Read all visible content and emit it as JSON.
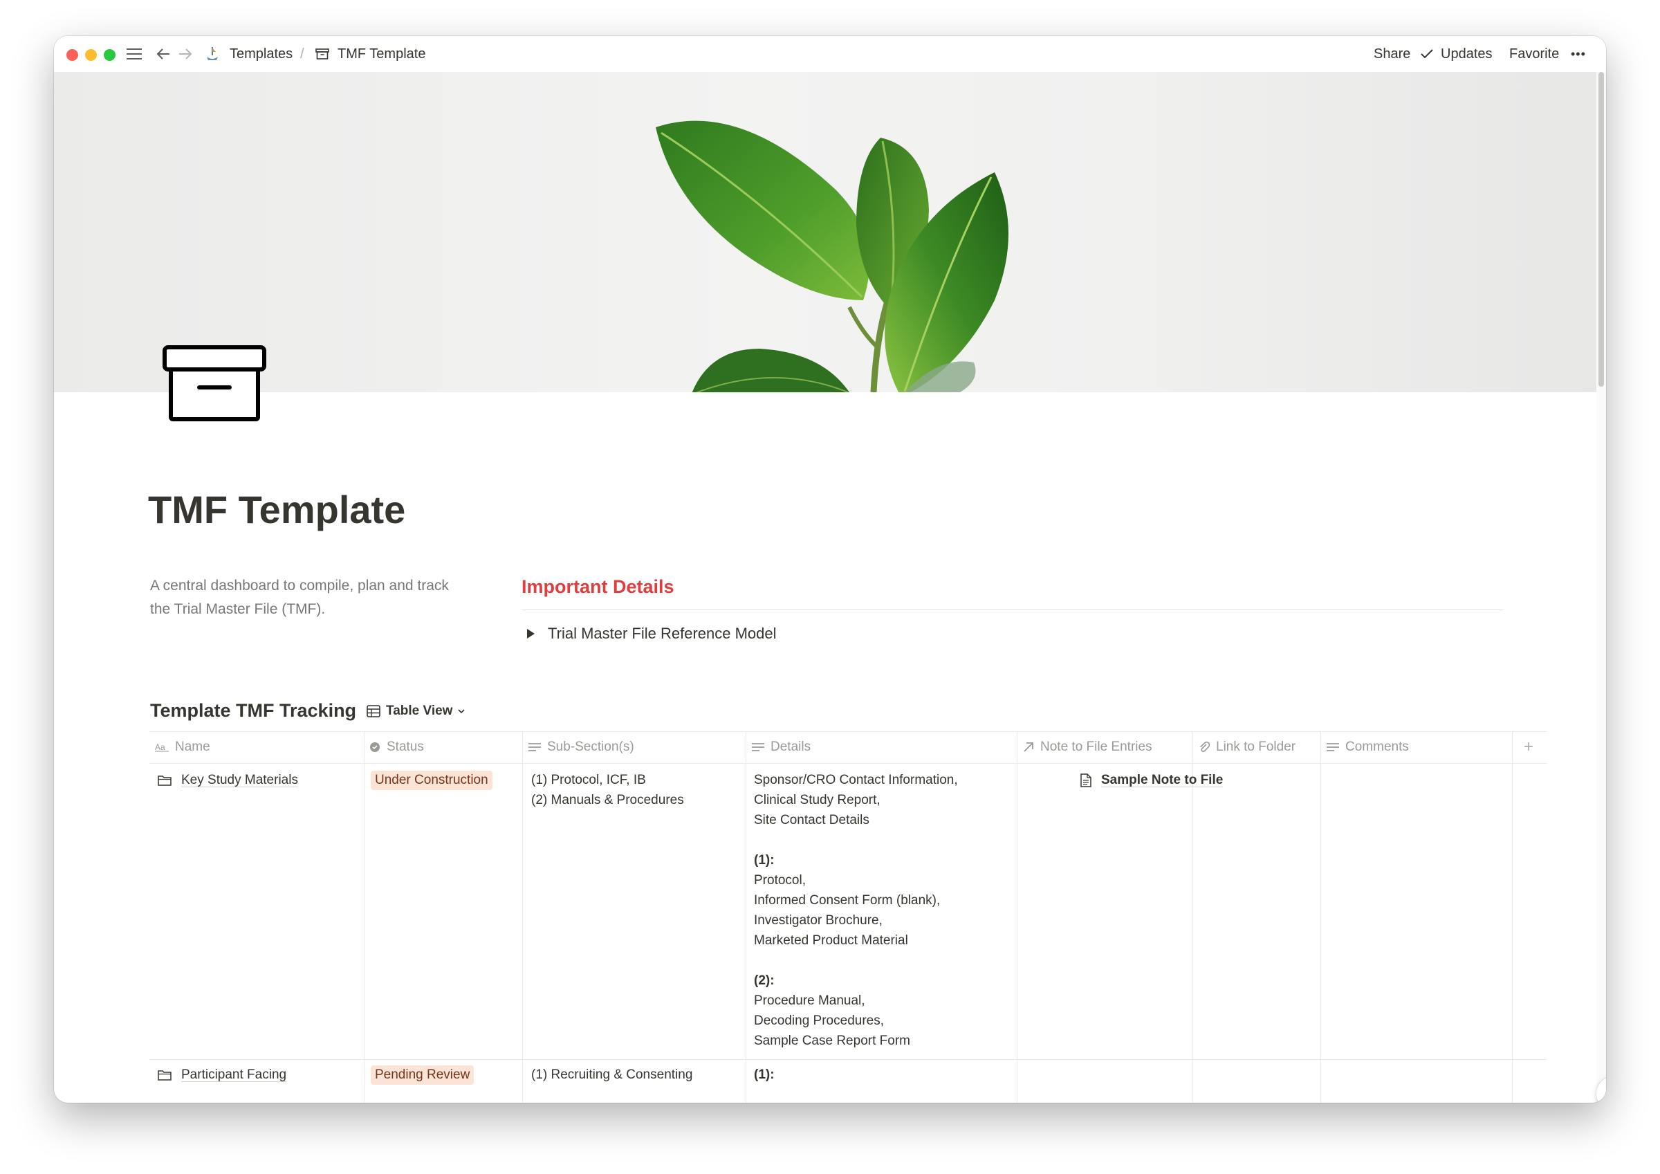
{
  "titlebar": {
    "breadcrumb_root": "Templates",
    "breadcrumb_sep": "/",
    "breadcrumb_page": "TMF Template",
    "share": "Share",
    "updates": "Updates",
    "favorite": "Favorite",
    "more": "•••"
  },
  "page": {
    "title": "TMF Template",
    "description": "A central dashboard to compile, plan and track the Trial Master File (TMF).",
    "important_heading": "Important Details",
    "toggle_label": "Trial Master File Reference Model"
  },
  "database": {
    "title": "Template TMF Tracking",
    "view_label": "Table View",
    "columns": [
      {
        "label": "Name",
        "icon": "text-icon"
      },
      {
        "label": "Status",
        "icon": "status-icon"
      },
      {
        "label": "Sub-Section(s)",
        "icon": "text-lines-icon"
      },
      {
        "label": "Details",
        "icon": "text-lines-icon"
      },
      {
        "label": "Note to File Entries",
        "icon": "relation-arrow-icon"
      },
      {
        "label": "Link to Folder",
        "icon": "paperclip-icon"
      },
      {
        "label": "Comments",
        "icon": "text-lines-icon"
      }
    ],
    "add_column": "+",
    "rows": [
      {
        "name": "Key Study Materials",
        "status": "Under Construction",
        "subsections": [
          "(1) Protocol, ICF, IB",
          "(2) Manuals & Procedures"
        ],
        "details": {
          "intro": [
            "Sponsor/CRO Contact Information,",
            "Clinical Study Report,",
            "Site Contact Details"
          ],
          "group1_label": "(1):",
          "group1": [
            "Protocol,",
            "Informed Consent Form (blank),",
            "Investigator Brochure,",
            "Marketed Product Material"
          ],
          "group2_label": "(2):",
          "group2": [
            "Procedure Manual,",
            "Decoding Procedures,",
            "Sample Case Report Form"
          ]
        },
        "note_to_file": "Sample Note to File"
      },
      {
        "name": "Participant Facing",
        "status": "Pending Review",
        "subsections": [
          "(1) Recruiting & Consenting"
        ],
        "details_label": "(1):"
      }
    ]
  },
  "help_button": "?",
  "colors": {
    "accent_red": "#e03e3e",
    "text": "#37352f",
    "muted": "#787774",
    "tag_orange_bg": "#fbe4d5"
  }
}
